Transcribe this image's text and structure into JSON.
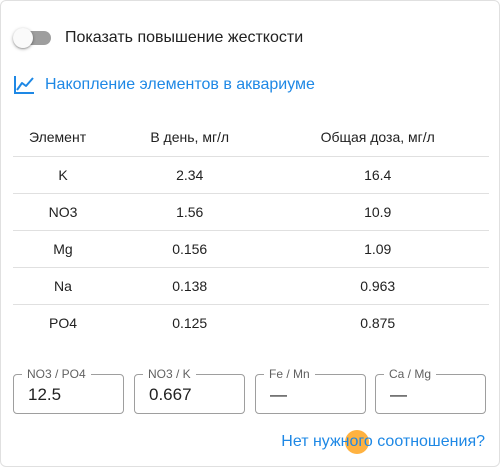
{
  "toggle": {
    "label": "Показать повышение жесткости",
    "checked": false
  },
  "chart_link": {
    "label": "Накопление элементов в аквариуме",
    "icon": "line-chart-icon"
  },
  "table": {
    "headers": [
      "Элемент",
      "В день, мг/л",
      "Общая доза, мг/л"
    ],
    "rows": [
      [
        "K",
        "2.34",
        "16.4"
      ],
      [
        "NO3",
        "1.56",
        "10.9"
      ],
      [
        "Mg",
        "0.156",
        "1.09"
      ],
      [
        "Na",
        "0.138",
        "0.963"
      ],
      [
        "PO4",
        "0.125",
        "0.875"
      ]
    ]
  },
  "ratios": [
    {
      "label": "NO3 / PO4",
      "value": "12.5"
    },
    {
      "label": "NO3 / K",
      "value": "0.667"
    },
    {
      "label": "Fe / Mn",
      "value": "—"
    },
    {
      "label": "Ca / Mg",
      "value": "—"
    }
  ],
  "ratio_link": {
    "label": "Нет нужного соотношения?"
  },
  "colors": {
    "accent": "#1e88e5",
    "toggle_track": "#9e9e9e",
    "touch_indicator": "#ff9800"
  }
}
